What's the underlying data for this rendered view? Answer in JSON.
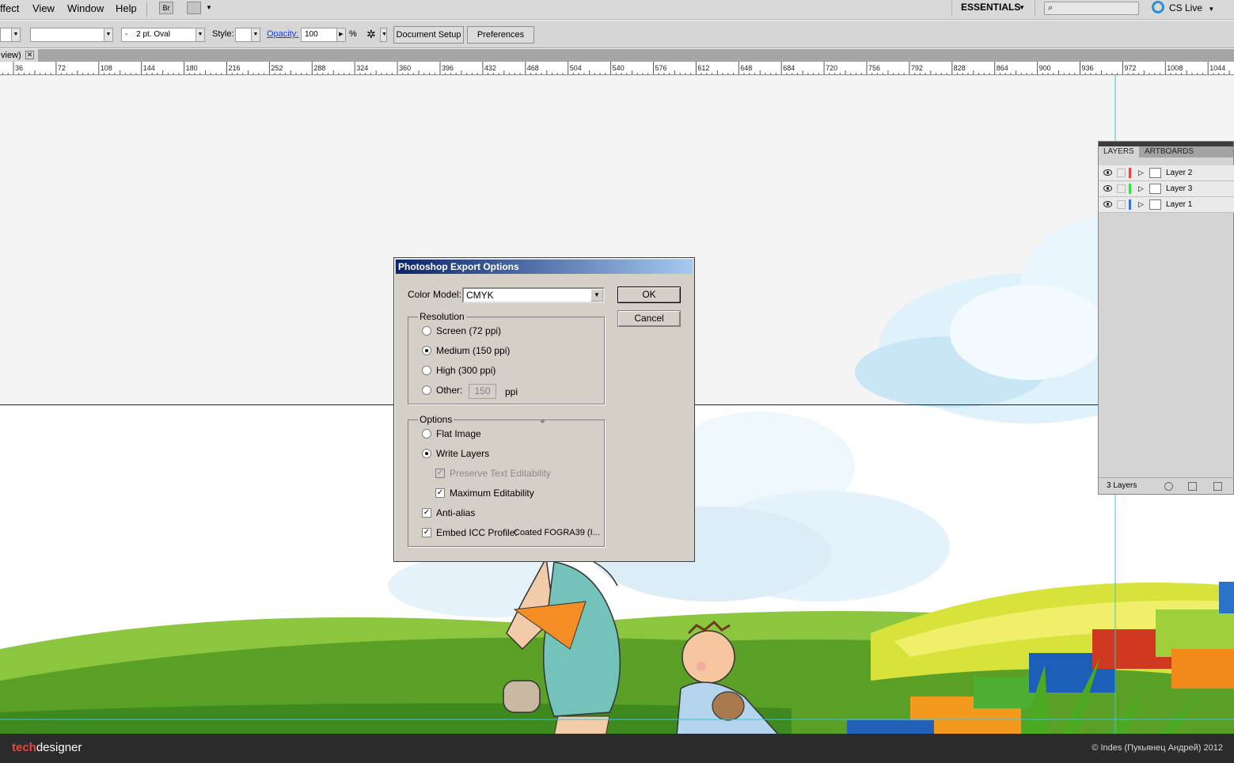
{
  "menu": {
    "items": [
      "ffect",
      "View",
      "Window",
      "Help"
    ],
    "bridge_label": "Br",
    "workspace": "ESSENTIALS",
    "cs_live": "CS Live"
  },
  "control_bar": {
    "brush": "2 pt. Oval",
    "brush_prefix": "-",
    "style_label": "Style:",
    "opacity_label": "Opacity:",
    "opacity_value": "100",
    "percent": "%",
    "document_setup": "Document Setup",
    "preferences": "Preferences"
  },
  "doc_tab": {
    "label": "view)",
    "close": "✕"
  },
  "ruler": {
    "ticks": [
      "36",
      "72",
      "108",
      "144",
      "180",
      "216",
      "252",
      "288",
      "324",
      "360",
      "396",
      "432",
      "468",
      "504",
      "540",
      "576",
      "612",
      "648",
      "684",
      "720",
      "756",
      "792",
      "828",
      "864",
      "900",
      "936",
      "972",
      "1008",
      "1044"
    ]
  },
  "dialog": {
    "title": "Photoshop Export Options",
    "color_model_label": "Color Model:",
    "color_model_value": "CMYK",
    "ok": "OK",
    "cancel": "Cancel",
    "resolution": {
      "title": "Resolution",
      "screen": "Screen (72 ppi)",
      "medium": "Medium (150 ppi)",
      "high": "High (300 ppi)",
      "other": "Other:",
      "other_value": "150",
      "ppi": "ppi",
      "selected": "medium"
    },
    "options": {
      "title": "Options",
      "flat": "Flat Image",
      "write_layers": "Write Layers",
      "preserve_text": "Preserve Text Editability",
      "max_edit": "Maximum Editability",
      "anti_alias": "Anti-alias",
      "embed_icc": "Embed ICC Profile:",
      "icc_profile": "Coated FOGRA39 (I...",
      "selected": "write_layers"
    }
  },
  "layers_panel": {
    "tab_layers": "LAYERS",
    "tab_artboards": "ARTBOARDS",
    "layers": [
      {
        "name": "Layer 2",
        "color": "#e8403a"
      },
      {
        "name": "Layer 3",
        "color": "#3ddc4a"
      },
      {
        "name": "Layer 1",
        "color": "#3b6fe0"
      }
    ],
    "count": "3 Layers"
  },
  "footer": {
    "brand_tech": "tech",
    "brand_designer": "designer",
    "copyright": "© Indes (Пукьянец Андрей) 2012"
  }
}
